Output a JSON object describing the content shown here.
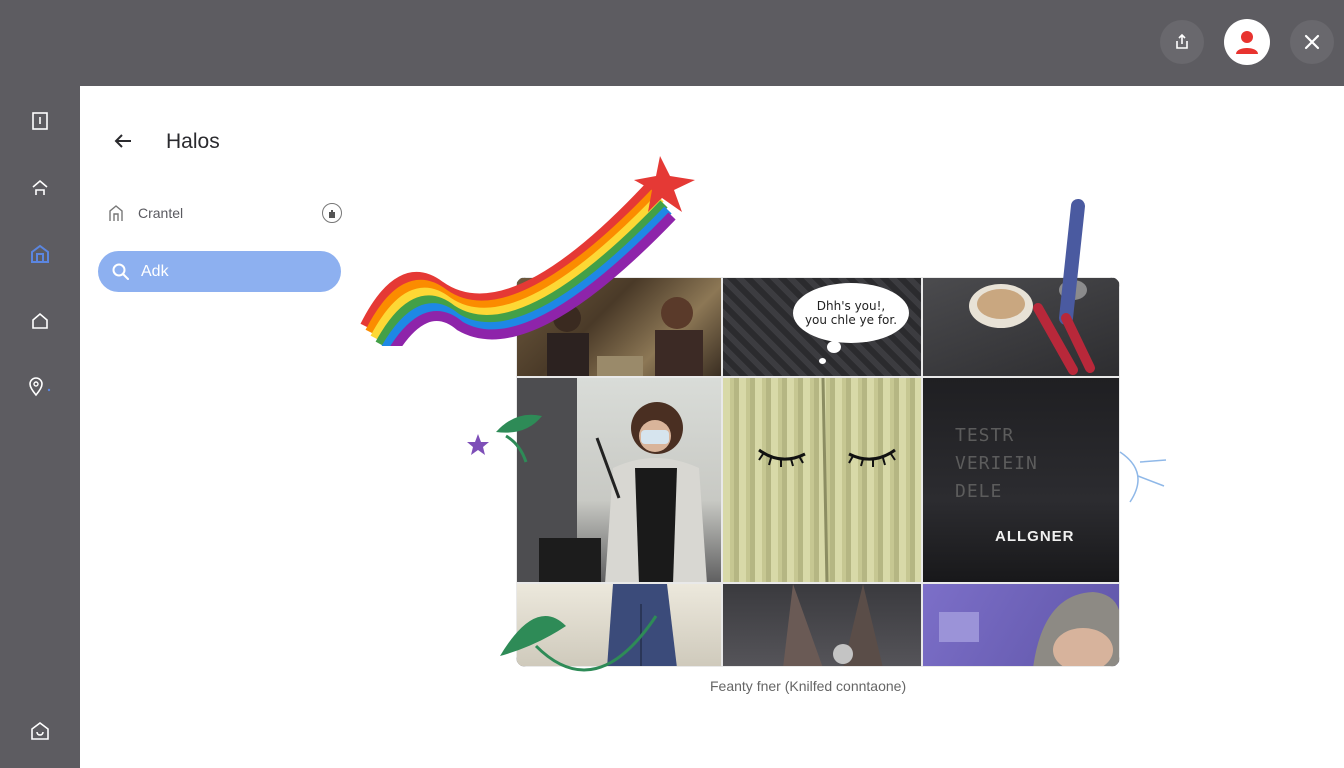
{
  "header": {
    "share_icon": "share-icon",
    "avatar_icon": "user-avatar-icon",
    "close_icon": "close-icon",
    "avatar_color": "#e8332f"
  },
  "rail": {
    "items": [
      {
        "icon": "book-icon"
      },
      {
        "icon": "home-icon"
      },
      {
        "icon": "building-icon",
        "active": true
      },
      {
        "icon": "house-outline-icon"
      },
      {
        "icon": "location-pin-icon"
      },
      {
        "icon": "settings-icon"
      }
    ],
    "accent": "#5b86e0"
  },
  "page": {
    "title": "Halos",
    "nav_item_label": "Crantel",
    "search_label": "Adk",
    "search_color": "#8db0f0"
  },
  "collage": {
    "speech_line1": "Dhh's you!,",
    "speech_line2": "you chle ye for.",
    "screen_text": [
      "TESTR",
      "VERIEIN",
      "DELE"
    ],
    "keyboard_label": "ALLGNER",
    "caption": "Feanty fner (Knilfed conntaone)"
  }
}
